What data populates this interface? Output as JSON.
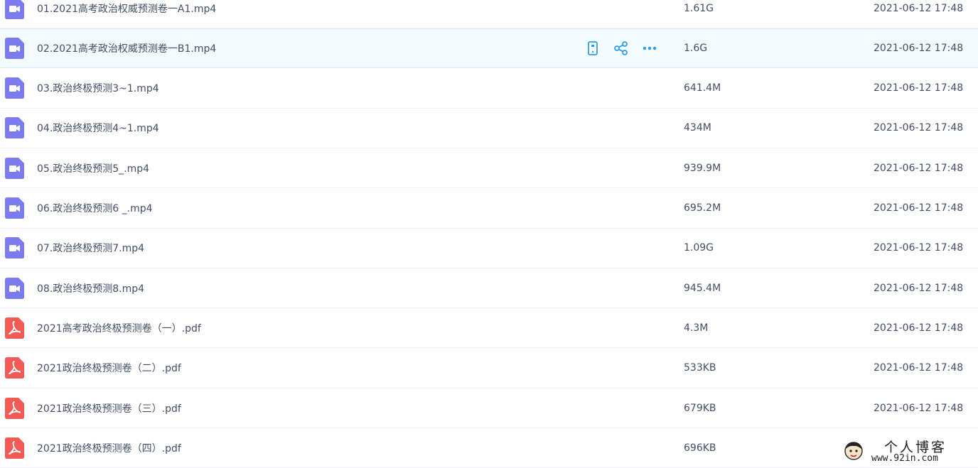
{
  "files": [
    {
      "name": "01.2021高考政治权威预测卷一A1.mp4",
      "type": "video",
      "size": "1.61G",
      "date": "2021-06-12 17:48",
      "hovered": false
    },
    {
      "name": "02.2021高考政治权威预测卷一B1.mp4",
      "type": "video",
      "size": "1.6G",
      "date": "2021-06-12 17:48",
      "hovered": true
    },
    {
      "name": "03.政治终极预测3~1.mp4",
      "type": "video",
      "size": "641.4M",
      "date": "2021-06-12 17:48",
      "hovered": false
    },
    {
      "name": "04.政治终极预测4~1.mp4",
      "type": "video",
      "size": "434M",
      "date": "2021-06-12 17:48",
      "hovered": false
    },
    {
      "name": "05.政治终极预测5_.mp4",
      "type": "video",
      "size": "939.9M",
      "date": "2021-06-12 17:48",
      "hovered": false
    },
    {
      "name": "06.政治终极预测6 _.mp4",
      "type": "video",
      "size": "695.2M",
      "date": "2021-06-12 17:48",
      "hovered": false
    },
    {
      "name": "07.政治终极预测7.mp4",
      "type": "video",
      "size": "1.09G",
      "date": "2021-06-12 17:48",
      "hovered": false
    },
    {
      "name": "08.政治终极预测8.mp4",
      "type": "video",
      "size": "945.4M",
      "date": "2021-06-12 17:48",
      "hovered": false
    },
    {
      "name": "2021高考政治终极预测卷（一）.pdf",
      "type": "pdf",
      "size": "4.3M",
      "date": "2021-06-12 17:48",
      "hovered": false
    },
    {
      "name": "2021政治终极预测卷（二）.pdf",
      "type": "pdf",
      "size": "533KB",
      "date": "2021-06-12 17:48",
      "hovered": false
    },
    {
      "name": "2021政治终极预测卷（三）.pdf",
      "type": "pdf",
      "size": "679KB",
      "date": "2021-06-12 17:48",
      "hovered": false
    },
    {
      "name": "2021政治终极预测卷（四）.pdf",
      "type": "pdf",
      "size": "696KB",
      "date": "",
      "hovered": false
    }
  ],
  "row_actions": [
    {
      "icon": "phone-icon",
      "label": "send to phone"
    },
    {
      "icon": "share-icon",
      "label": "share"
    },
    {
      "icon": "more-icon",
      "label": "more"
    }
  ],
  "icons": {
    "video": "video-file-icon",
    "pdf": "pdf-file-icon"
  },
  "colors": {
    "video_icon": "#7b7bf0",
    "pdf_icon": "#f25a56",
    "action_icon": "#2e9ee8",
    "hover_bg": "#f4fbfe",
    "text": "#424e67"
  },
  "watermark": {
    "title": "个人博客",
    "url": "www.92in.com"
  }
}
